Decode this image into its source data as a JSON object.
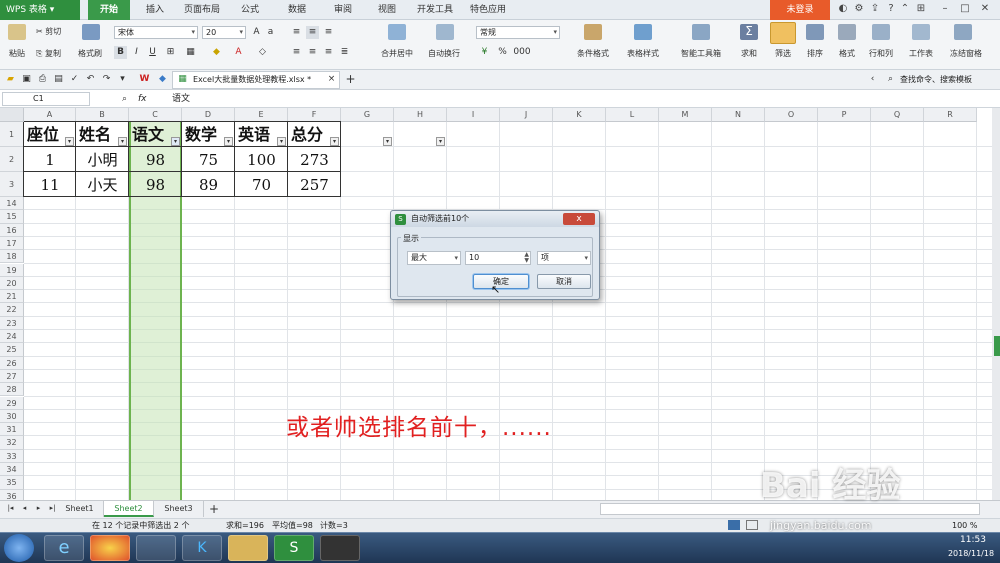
{
  "titlebar": {
    "app_name": "WPS 表格",
    "menu_tabs": [
      "开始",
      "插入",
      "页面布局",
      "公式",
      "数据",
      "审阅",
      "视图",
      "开发工具",
      "特色应用"
    ],
    "login": "未登录"
  },
  "ribbon": {
    "paste": "粘贴",
    "cut": "剪切",
    "copy": "复制",
    "format_painter": "格式刷",
    "font_name": "宋体",
    "font_size": "20",
    "merge_center": "合并居中",
    "wrap_text": "自动换行",
    "number_format": "常规",
    "conditional_format": "条件格式",
    "table_style": "表格样式",
    "smart_toolbox": "智能工具箱",
    "sum": "求和",
    "filter": "筛选",
    "sort": "排序",
    "format": "格式",
    "rows_cols": "行和列",
    "worksheet": "工作表",
    "freeze": "冻结窗格",
    "percent": "%",
    "thousands": "000",
    "bold": "B",
    "italic": "I",
    "underline": "U"
  },
  "doc_tab": {
    "title": "Excel大批量数据处理教程.xlsx *",
    "search": "查找命令、搜索模板"
  },
  "formula_bar": {
    "name_box": "C1",
    "fx": "fx",
    "content": "语文"
  },
  "columns": [
    "A",
    "B",
    "C",
    "D",
    "E",
    "F",
    "G",
    "H",
    "I",
    "J",
    "K",
    "L",
    "M",
    "N",
    "O",
    "P",
    "Q",
    "R"
  ],
  "rows": [
    "1",
    "2",
    "3",
    "14",
    "15",
    "16",
    "17",
    "18",
    "19",
    "20",
    "21",
    "22",
    "23",
    "24",
    "25",
    "26",
    "27",
    "28",
    "29",
    "30",
    "31",
    "32",
    "33",
    "34",
    "35",
    "36"
  ],
  "table": {
    "headers": [
      "座位",
      "姓名",
      "语文",
      "数学",
      "英语",
      "总分"
    ],
    "rows": [
      [
        "1",
        "小明",
        "98",
        "75",
        "100",
        "273"
      ],
      [
        "11",
        "小天",
        "98",
        "89",
        "70",
        "257"
      ]
    ]
  },
  "dialog": {
    "title": "自动筛选前10个",
    "group_label": "显示",
    "type_value": "最大",
    "count_value": "10",
    "unit_value": "项",
    "ok_label": "确定",
    "cancel_label": "取消",
    "close_label": "x"
  },
  "annotation": "或者帅选排名前十，......",
  "sheets": [
    "Sheet1",
    "Sheet2",
    "Sheet3"
  ],
  "active_sheet": "Sheet2",
  "add_sheet": "+",
  "status": {
    "filter_info": "在 12 个记录中筛选出 2 个",
    "sum": "求和=196",
    "avg": "平均值=98",
    "count": "计数=3",
    "zoom": "100 %"
  },
  "taskbar": {
    "time": "11:53",
    "date": "2018/11/18"
  },
  "watermark": {
    "brand": "Bai 经验",
    "url": "jingyan.baidu.com"
  },
  "colors": {
    "accent_green": "#3a9a4a",
    "filter_highlight": "#c4e4b5",
    "annotation_red": "#e12020"
  }
}
